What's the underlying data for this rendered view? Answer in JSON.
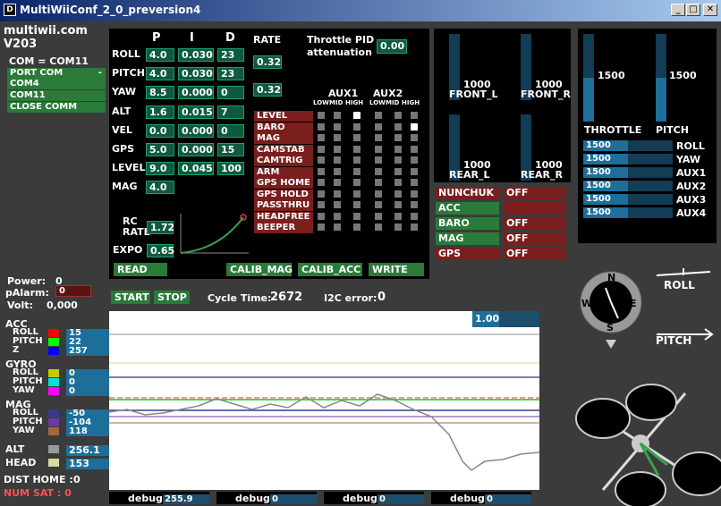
{
  "window": {
    "title": "MultiWiiConf_2_0_preversion4",
    "min": "_",
    "max": "□",
    "close": "✕"
  },
  "brand": {
    "name": "multiwii.com",
    "version": "V203"
  },
  "com": {
    "label": "COM = COM11",
    "port_label": "PORT COM",
    "ports": [
      "COM4",
      "COM11"
    ],
    "close": "CLOSE COMM"
  },
  "pid": {
    "headers": {
      "p": "P",
      "i": "I",
      "d": "D",
      "rate": "RATE"
    },
    "rows": [
      {
        "name": "ROLL",
        "p": "4.0",
        "i": "0.030",
        "d": "23"
      },
      {
        "name": "PITCH",
        "p": "4.0",
        "i": "0.030",
        "d": "23"
      },
      {
        "name": "YAW",
        "p": "8.5",
        "i": "0.000",
        "d": "0"
      },
      {
        "name": "ALT",
        "p": "1.6",
        "i": "0.015",
        "d": "7"
      },
      {
        "name": "VEL",
        "p": "0.0",
        "i": "0.000",
        "d": "0"
      },
      {
        "name": "GPS",
        "p": "5.0",
        "i": "0.000",
        "d": "15"
      },
      {
        "name": "LEVEL",
        "p": "9.0",
        "i": "0.045",
        "d": "100"
      },
      {
        "name": "MAG",
        "p": "4.0"
      }
    ],
    "rates": [
      "0.32",
      "0.32"
    ],
    "throttle_pid_label": "Throttle PID attenuation",
    "throttle_pid_value": "0.00",
    "rc_rate_label": "RC RATE",
    "rc_rate_value": "1.72",
    "expo_label": "EXPO",
    "expo_value": "0.65"
  },
  "aux": {
    "aux1": "AUX1",
    "aux2": "AUX2",
    "levels": [
      "LOW",
      "MID",
      "HIGH",
      "LOW",
      "MID",
      "HIGH"
    ],
    "modes": [
      "LEVEL",
      "BARO",
      "MAG",
      "CAMSTAB",
      "CAMTRIG",
      "ARM",
      "GPS HOME",
      "GPS HOLD",
      "PASSTHRU",
      "HEADFREE",
      "BEEPER"
    ],
    "checked": [
      [
        0,
        2
      ],
      [
        1,
        5
      ]
    ]
  },
  "buttons": {
    "read": "READ",
    "calib_mag": "CALIB_MAG",
    "calib_acc": "CALIB_ACC",
    "write": "WRITE",
    "start": "START",
    "stop": "STOP"
  },
  "cycle": {
    "label": "Cycle Time:",
    "value": "2672",
    "i2c_label": "I2C error:",
    "i2c_value": "0"
  },
  "motors": [
    {
      "name": "FRONT_L",
      "value": "1000"
    },
    {
      "name": "FRONT_R",
      "value": "1000"
    },
    {
      "name": "REAR_L",
      "value": "1000"
    },
    {
      "name": "REAR_R",
      "value": "1000"
    }
  ],
  "sensors_status": [
    {
      "name": "NUNCHUK",
      "state": "OFF",
      "active": false
    },
    {
      "name": "ACC",
      "state": "",
      "active": true
    },
    {
      "name": "BARO",
      "state": "OFF",
      "active": true
    },
    {
      "name": "MAG",
      "state": "OFF",
      "active": true
    },
    {
      "name": "GPS",
      "state": "OFF",
      "active": false
    }
  ],
  "rc": {
    "throttle": {
      "name": "THROTTLE",
      "value": "1500",
      "level": 0.5
    },
    "pitch": {
      "name": "PITCH",
      "value": "1500",
      "level": 0.5
    },
    "channels": [
      {
        "name": "ROLL",
        "value": "1500"
      },
      {
        "name": "YAW",
        "value": "1500"
      },
      {
        "name": "AUX1",
        "value": "1500"
      },
      {
        "name": "AUX2",
        "value": "1500"
      },
      {
        "name": "AUX3",
        "value": "1500"
      },
      {
        "name": "AUX4",
        "value": "1500"
      }
    ]
  },
  "power": {
    "power_label": "Power:",
    "power_value": "0",
    "palarm_label": "pAlarm:",
    "palarm_value": "0",
    "volt_label": "Volt:",
    "volt_value": "0,000"
  },
  "sensors": {
    "acc_label": "ACC",
    "gyro_label": "GYRO",
    "mag_label": "MAG",
    "acc": [
      {
        "name": "ROLL",
        "value": "15",
        "color": "#ff0000"
      },
      {
        "name": "PITCH",
        "value": "22",
        "color": "#00ff00"
      },
      {
        "name": "Z",
        "value": "257",
        "color": "#0000ff"
      }
    ],
    "gyro": [
      {
        "name": "ROLL",
        "value": "0",
        "color": "#c8c800"
      },
      {
        "name": "PITCH",
        "value": "0",
        "color": "#00e0e0"
      },
      {
        "name": "YAW",
        "value": "0",
        "color": "#ff00ff"
      }
    ],
    "mag": [
      {
        "name": "ROLL",
        "value": "-50",
        "color": "#3a3a8a"
      },
      {
        "name": "PITCH",
        "value": "-104",
        "color": "#6a3aa0"
      },
      {
        "name": "YAW",
        "value": "118",
        "color": "#a06a3a"
      }
    ],
    "alt_label": "ALT",
    "alt_value": "256.1",
    "alt_color": "#9a9a9a",
    "head_label": "HEAD",
    "head_value": "153",
    "head_color": "#d8d8a0"
  },
  "gps": {
    "dist_label": "DIST HOME :",
    "dist_value": "0",
    "numsat_label": "NUM SAT",
    "numsat_value": ": 0"
  },
  "graph": {
    "scale": "1.00"
  },
  "debug": [
    {
      "name": "debug1",
      "value": "255.9"
    },
    {
      "name": "debug2",
      "value": "0"
    },
    {
      "name": "debug3",
      "value": "0"
    },
    {
      "name": "debug4",
      "value": "0"
    }
  ],
  "compass": {
    "n": "N",
    "s": "S",
    "e": "E",
    "w": "W"
  },
  "attitude": {
    "roll": "ROLL",
    "pitch": "PITCH"
  }
}
